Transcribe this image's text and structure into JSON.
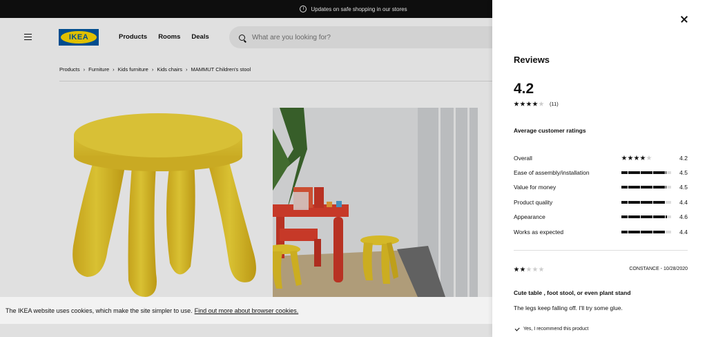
{
  "topbar": {
    "message": "Updates on safe shopping in our stores"
  },
  "header": {
    "logo_text": "IKEA",
    "nav": [
      "Products",
      "Rooms",
      "Deals"
    ],
    "search_placeholder": "What are you looking for?"
  },
  "breadcrumb": [
    "Products",
    "Furniture",
    "Kids furniture",
    "Kids chairs",
    "MAMMUT Children's stool"
  ],
  "cookie": {
    "text": "The IKEA website uses cookies, which make the site simpler to use.",
    "link": "Find out more about browser cookies."
  },
  "reviews": {
    "title": "Reviews",
    "score": "4.2",
    "stars": 4.2,
    "count": "(11)",
    "avg_heading": "Average customer ratings",
    "ratings": [
      {
        "label": "Overall",
        "value": "4.2",
        "display": "stars"
      },
      {
        "label": "Ease of assembly/installation",
        "value": "4.5",
        "display": "bar"
      },
      {
        "label": "Value for money",
        "value": "4.5",
        "display": "bar"
      },
      {
        "label": "Product quality",
        "value": "4.4",
        "display": "bar"
      },
      {
        "label": "Appearance",
        "value": "4.6",
        "display": "bar"
      },
      {
        "label": "Works as expected",
        "value": "4.4",
        "display": "bar"
      }
    ],
    "review": {
      "stars": 2,
      "author": "CONSTANCE - 10/28/2020",
      "title": "Cute table , foot stool, or even plant stand",
      "body": "The legs keep falling off. I'll try some glue.",
      "recommend": "Yes, I recommend this product"
    }
  },
  "colors": {
    "ikea_blue": "#0058a3",
    "ikea_yellow": "#ffdb00",
    "stool_yellow": "#f2d22e",
    "table_red": "#e2412e"
  },
  "icons": [
    "info-icon",
    "hamburger-icon",
    "search-icon",
    "close-icon",
    "star-icon",
    "check-icon"
  ]
}
